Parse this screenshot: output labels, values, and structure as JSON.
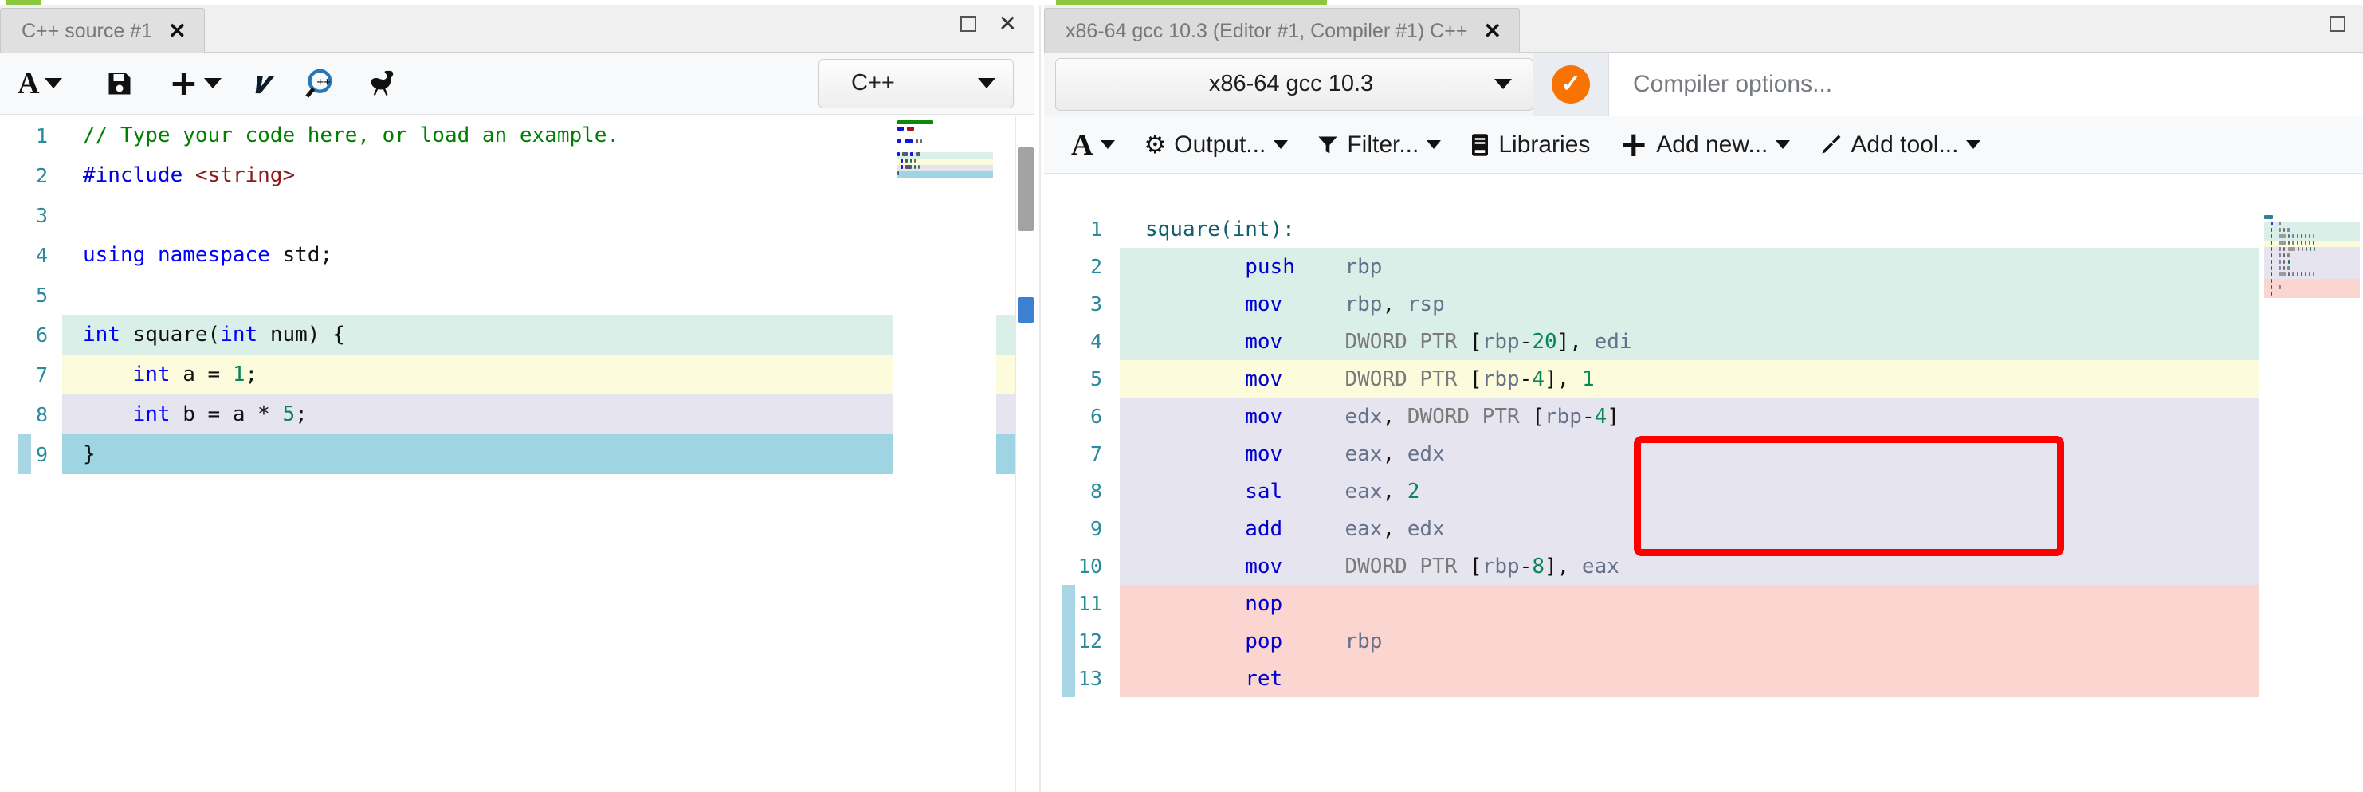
{
  "window": {
    "maximize_icon": "maximize-icon",
    "close_icon": "close-icon"
  },
  "left_panel": {
    "tab": {
      "title": "C++ source #1",
      "close": "✕"
    },
    "toolbar": [
      {
        "name": "font-size-button",
        "icon": "font-A-icon",
        "label": "A",
        "caret": true
      },
      {
        "name": "save-button",
        "icon": "floppy-save-icon",
        "label": "",
        "caret": false
      },
      {
        "name": "add-button",
        "icon": "plus-icon",
        "label": "+",
        "caret": true
      },
      {
        "name": "vim-mode-button",
        "icon": "vim-v-icon",
        "label": "v",
        "caret": false
      },
      {
        "name": "cppreference-button",
        "icon": "magnifier-cpp-icon",
        "label": "",
        "caret": false
      },
      {
        "name": "quickbench-button",
        "icon": "ostrich-icon",
        "label": "",
        "caret": false
      }
    ],
    "language_select": {
      "value": "C++",
      "caret": "▼"
    },
    "code": [
      {
        "n": "1",
        "hl": "none",
        "tokens": [
          {
            "t": "// Type your code here, or load an example.",
            "c": "c-com"
          }
        ]
      },
      {
        "n": "2",
        "hl": "none",
        "tokens": [
          {
            "t": "#include",
            "c": "c-pre"
          },
          {
            "t": " ",
            "c": "c-plain"
          },
          {
            "t": "<string>",
            "c": "c-str"
          }
        ]
      },
      {
        "n": "3",
        "hl": "none",
        "tokens": [
          {
            "t": "",
            "c": "c-plain"
          }
        ]
      },
      {
        "n": "4",
        "hl": "none",
        "tokens": [
          {
            "t": "using",
            "c": "c-key"
          },
          {
            "t": " ",
            "c": "c-plain"
          },
          {
            "t": "namespace",
            "c": "c-key"
          },
          {
            "t": " ",
            "c": "c-plain"
          },
          {
            "t": "std",
            "c": "c-plain"
          },
          {
            "t": ";",
            "c": "c-punc"
          }
        ]
      },
      {
        "n": "5",
        "hl": "none",
        "tokens": [
          {
            "t": "",
            "c": "c-plain"
          }
        ]
      },
      {
        "n": "6",
        "hl": "mint",
        "tokens": [
          {
            "t": "int",
            "c": "c-type"
          },
          {
            "t": " square(",
            "c": "c-plain"
          },
          {
            "t": "int",
            "c": "c-type"
          },
          {
            "t": " num) {",
            "c": "c-plain"
          }
        ]
      },
      {
        "n": "7",
        "hl": "yellow",
        "tokens": [
          {
            "t": "    ",
            "c": "c-plain"
          },
          {
            "t": "int",
            "c": "c-type"
          },
          {
            "t": " a = ",
            "c": "c-plain"
          },
          {
            "t": "1",
            "c": "c-num"
          },
          {
            "t": ";",
            "c": "c-punc"
          }
        ]
      },
      {
        "n": "8",
        "hl": "lav",
        "tokens": [
          {
            "t": "    ",
            "c": "c-plain"
          },
          {
            "t": "int",
            "c": "c-type"
          },
          {
            "t": " b = a * ",
            "c": "c-plain"
          },
          {
            "t": "5",
            "c": "c-num"
          },
          {
            "t": ";",
            "c": "c-punc"
          }
        ]
      },
      {
        "n": "9",
        "hl": "cyan",
        "tokens": [
          {
            "t": "}",
            "c": "c-plain"
          }
        ],
        "gutter_marker": true
      }
    ]
  },
  "right_panel": {
    "tab": {
      "title": "x86-64 gcc 10.3 (Editor #1, Compiler #1) C++",
      "close": "✕"
    },
    "compiler_select": {
      "value": "x86-64 gcc 10.3",
      "caret": "▼"
    },
    "status_badge": {
      "icon": "check-circle-icon",
      "symbol": "✓",
      "color": "#f97300"
    },
    "compiler_options": {
      "value": "",
      "placeholder": "Compiler options..."
    },
    "output_toolbar": [
      {
        "name": "font-size-button",
        "icon": "font-A-icon",
        "label": "",
        "caret": true
      },
      {
        "name": "output-button",
        "icon": "gear-icon",
        "label": "Output...",
        "caret": true
      },
      {
        "name": "filter-button",
        "icon": "funnel-icon",
        "label": "Filter...",
        "caret": true
      },
      {
        "name": "libraries-button",
        "icon": "book-icon",
        "label": "Libraries",
        "caret": false
      },
      {
        "name": "add-new-button",
        "icon": "plus-icon",
        "label": "Add new...",
        "caret": true
      },
      {
        "name": "add-tool-button",
        "icon": "screwdriver-icon",
        "label": "Add tool...",
        "caret": true
      }
    ],
    "asm": [
      {
        "n": "1",
        "hl": "none",
        "tokens": [
          {
            "t": "square(int):",
            "c": "c-lbl"
          }
        ]
      },
      {
        "n": "2",
        "hl": "mint",
        "tokens": [
          {
            "t": "        ",
            "c": "c-plain"
          },
          {
            "t": "push",
            "c": "c-op"
          },
          {
            "t": "    ",
            "c": "c-plain"
          },
          {
            "t": "rbp",
            "c": "c-reg"
          }
        ]
      },
      {
        "n": "3",
        "hl": "mint",
        "tokens": [
          {
            "t": "        ",
            "c": "c-plain"
          },
          {
            "t": "mov",
            "c": "c-op"
          },
          {
            "t": "     ",
            "c": "c-plain"
          },
          {
            "t": "rbp",
            "c": "c-reg"
          },
          {
            "t": ",",
            "c": "c-punc"
          },
          {
            "t": " rsp",
            "c": "c-reg"
          }
        ]
      },
      {
        "n": "4",
        "hl": "mint",
        "tokens": [
          {
            "t": "        ",
            "c": "c-plain"
          },
          {
            "t": "mov",
            "c": "c-op"
          },
          {
            "t": "     ",
            "c": "c-plain"
          },
          {
            "t": "DWORD PTR ",
            "c": "c-ptr"
          },
          {
            "t": "[",
            "c": "c-punc"
          },
          {
            "t": "rbp",
            "c": "c-reg"
          },
          {
            "t": "-",
            "c": "c-punc"
          },
          {
            "t": "20",
            "c": "c-num"
          },
          {
            "t": "]",
            "c": "c-punc"
          },
          {
            "t": ",",
            "c": "c-punc"
          },
          {
            "t": " edi",
            "c": "c-reg"
          }
        ]
      },
      {
        "n": "5",
        "hl": "yellow",
        "tokens": [
          {
            "t": "        ",
            "c": "c-plain"
          },
          {
            "t": "mov",
            "c": "c-op"
          },
          {
            "t": "     ",
            "c": "c-plain"
          },
          {
            "t": "DWORD PTR ",
            "c": "c-ptr"
          },
          {
            "t": "[",
            "c": "c-punc"
          },
          {
            "t": "rbp",
            "c": "c-reg"
          },
          {
            "t": "-",
            "c": "c-punc"
          },
          {
            "t": "4",
            "c": "c-num"
          },
          {
            "t": "]",
            "c": "c-punc"
          },
          {
            "t": ", ",
            "c": "c-punc"
          },
          {
            "t": "1",
            "c": "c-num"
          }
        ]
      },
      {
        "n": "6",
        "hl": "lav",
        "tokens": [
          {
            "t": "        ",
            "c": "c-plain"
          },
          {
            "t": "mov",
            "c": "c-op"
          },
          {
            "t": "     ",
            "c": "c-plain"
          },
          {
            "t": "edx",
            "c": "c-reg"
          },
          {
            "t": ",",
            "c": "c-punc"
          },
          {
            "t": " ",
            "c": "c-plain"
          },
          {
            "t": "DWORD PTR ",
            "c": "c-ptr"
          },
          {
            "t": "[",
            "c": "c-punc"
          },
          {
            "t": "rbp",
            "c": "c-reg"
          },
          {
            "t": "-",
            "c": "c-punc"
          },
          {
            "t": "4",
            "c": "c-num"
          },
          {
            "t": "]",
            "c": "c-punc"
          }
        ]
      },
      {
        "n": "7",
        "hl": "lav",
        "tokens": [
          {
            "t": "        ",
            "c": "c-plain"
          },
          {
            "t": "mov",
            "c": "c-op"
          },
          {
            "t": "     ",
            "c": "c-plain"
          },
          {
            "t": "eax",
            "c": "c-reg"
          },
          {
            "t": ",",
            "c": "c-punc"
          },
          {
            "t": " edx",
            "c": "c-reg"
          }
        ]
      },
      {
        "n": "8",
        "hl": "lav",
        "tokens": [
          {
            "t": "        ",
            "c": "c-plain"
          },
          {
            "t": "sal",
            "c": "c-op"
          },
          {
            "t": "     ",
            "c": "c-plain"
          },
          {
            "t": "eax",
            "c": "c-reg"
          },
          {
            "t": ",",
            "c": "c-punc"
          },
          {
            "t": " ",
            "c": "c-plain"
          },
          {
            "t": "2",
            "c": "c-num"
          }
        ]
      },
      {
        "n": "9",
        "hl": "lav",
        "tokens": [
          {
            "t": "        ",
            "c": "c-plain"
          },
          {
            "t": "add",
            "c": "c-op"
          },
          {
            "t": "     ",
            "c": "c-plain"
          },
          {
            "t": "eax",
            "c": "c-reg"
          },
          {
            "t": ",",
            "c": "c-punc"
          },
          {
            "t": " edx",
            "c": "c-reg"
          }
        ]
      },
      {
        "n": "10",
        "hl": "lav",
        "tokens": [
          {
            "t": "        ",
            "c": "c-plain"
          },
          {
            "t": "mov",
            "c": "c-op"
          },
          {
            "t": "     ",
            "c": "c-plain"
          },
          {
            "t": "DWORD PTR ",
            "c": "c-ptr"
          },
          {
            "t": "[",
            "c": "c-punc"
          },
          {
            "t": "rbp",
            "c": "c-reg"
          },
          {
            "t": "-",
            "c": "c-punc"
          },
          {
            "t": "8",
            "c": "c-num"
          },
          {
            "t": "]",
            "c": "c-punc"
          },
          {
            "t": ",",
            "c": "c-punc"
          },
          {
            "t": " eax",
            "c": "c-reg"
          }
        ]
      },
      {
        "n": "11",
        "hl": "pink",
        "tokens": [
          {
            "t": "        ",
            "c": "c-plain"
          },
          {
            "t": "nop",
            "c": "c-op"
          }
        ],
        "gutter_marker": true
      },
      {
        "n": "12",
        "hl": "pink",
        "tokens": [
          {
            "t": "        ",
            "c": "c-plain"
          },
          {
            "t": "pop",
            "c": "c-op"
          },
          {
            "t": "     ",
            "c": "c-plain"
          },
          {
            "t": "rbp",
            "c": "c-reg"
          }
        ],
        "gutter_marker": true
      },
      {
        "n": "13",
        "hl": "pink",
        "tokens": [
          {
            "t": "        ",
            "c": "c-plain"
          },
          {
            "t": "ret",
            "c": "c-op"
          }
        ],
        "gutter_marker": true
      }
    ],
    "annotation": {
      "name": "red-highlight-box",
      "color": "#fe0000",
      "covers_lines": [
        "7",
        "8",
        "9"
      ]
    }
  },
  "highlight_colors": {
    "mint": "#d9efe8",
    "yellow": "#fcfbdc",
    "lav": "#e6e4ef",
    "cyan": "#9fd4e3",
    "pink": "#fbd5cf",
    "none": "#ffffff"
  }
}
